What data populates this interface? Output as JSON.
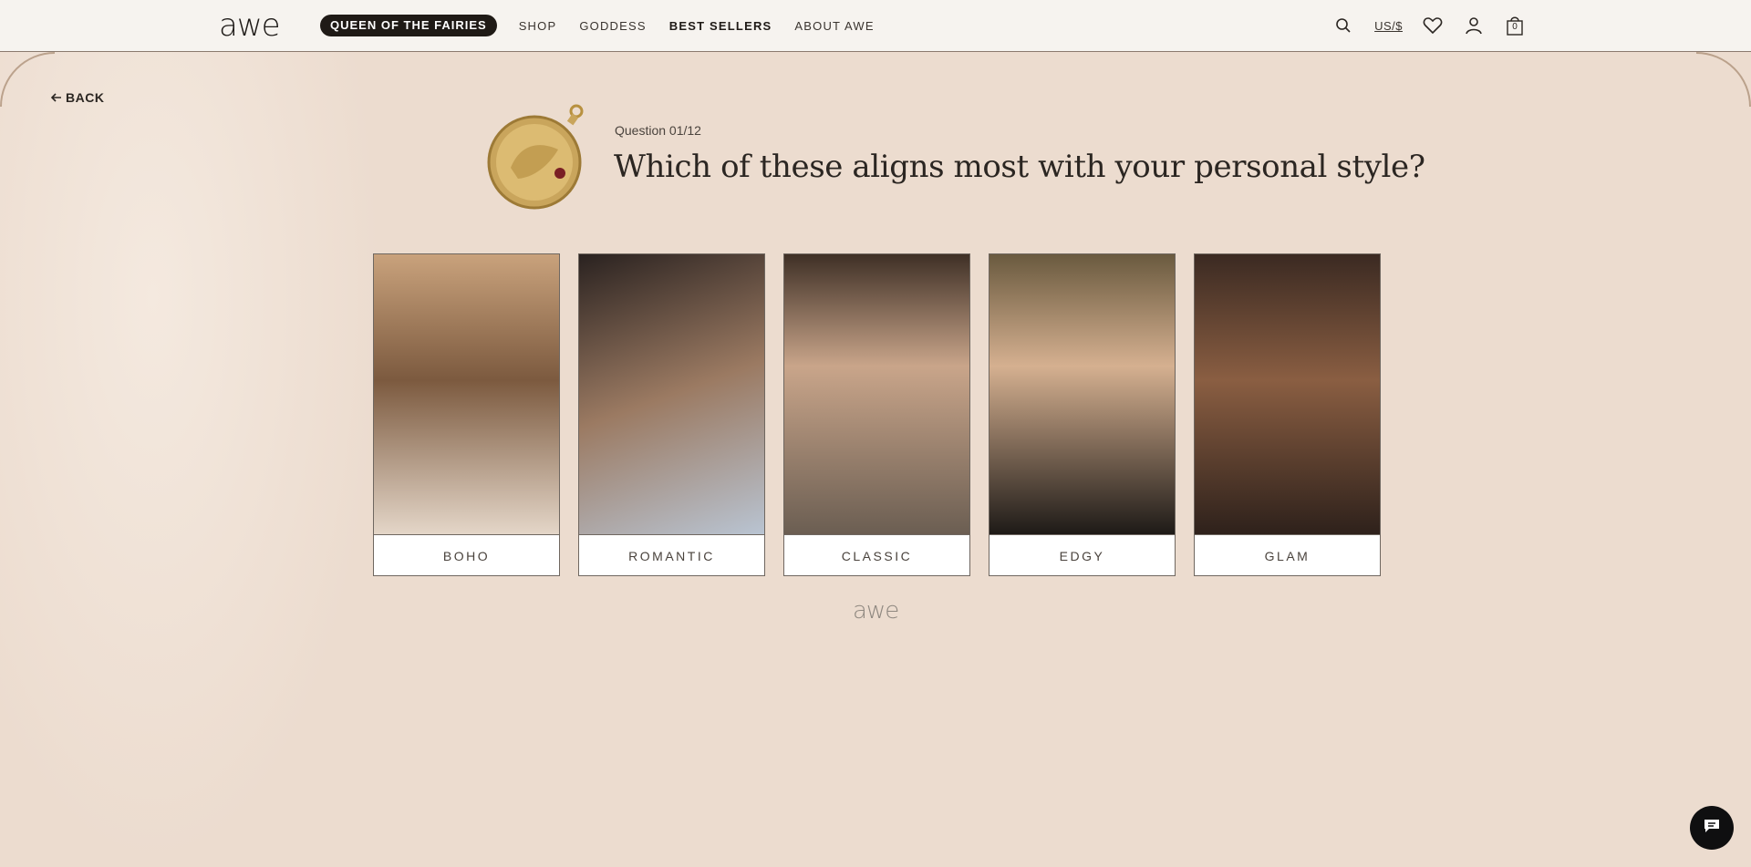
{
  "header": {
    "logo": "awe",
    "promo_pill": "QUEEN OF THE FAIRIES",
    "nav": [
      "SHOP",
      "GODDESS",
      "BEST SELLERS",
      "ABOUT AWE"
    ],
    "currency": "US/$",
    "cart_count": "0"
  },
  "back_label": "BACK",
  "question": {
    "label": "Question 01/12",
    "title": "Which of these aligns most with your personal style?"
  },
  "options": [
    {
      "label": "BOHO",
      "tone": "#a9825f"
    },
    {
      "label": "ROMANTIC",
      "tone": "#6d5a49"
    },
    {
      "label": "CLASSIC",
      "tone": "#8a7565"
    },
    {
      "label": "EDGY",
      "tone": "#5e4a3a"
    },
    {
      "label": "GLAM",
      "tone": "#4a3428"
    }
  ],
  "footer_logo": "awe",
  "icons": [
    "search-icon",
    "heart-icon",
    "user-icon",
    "bag-icon",
    "chat-icon",
    "arrow-left-icon"
  ]
}
